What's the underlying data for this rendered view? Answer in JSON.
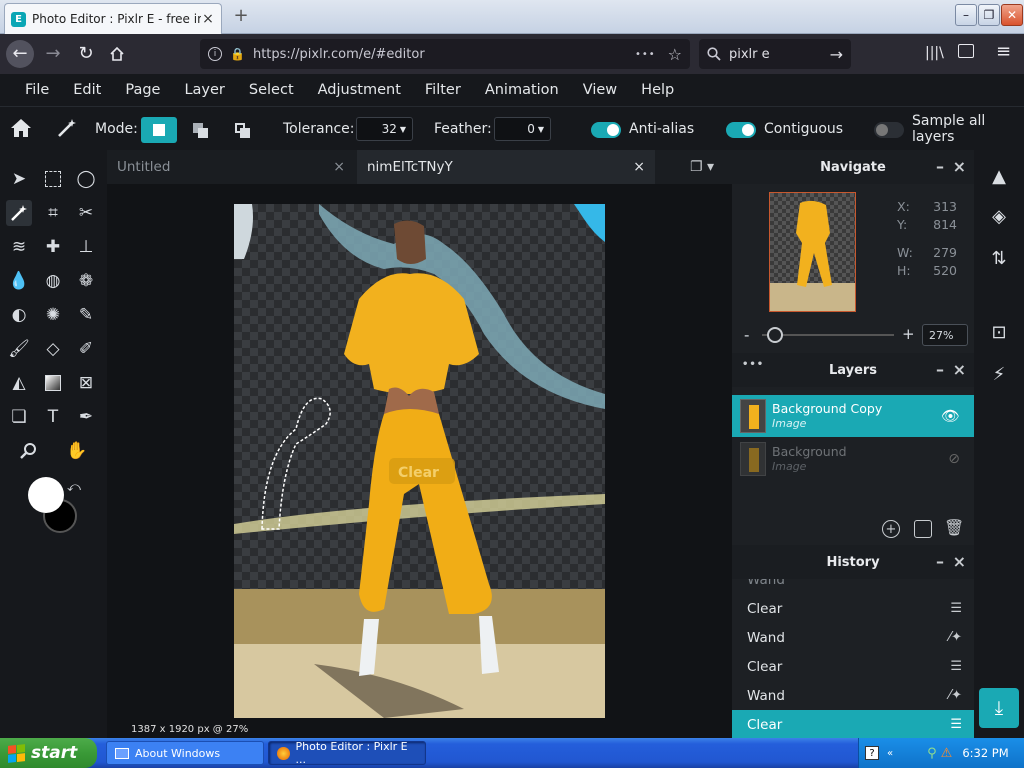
{
  "browser": {
    "tab_title": "Photo Editor : Pixlr E - free image e",
    "url": "https://pixlr.com/e/#editor",
    "search_text": "pixlr e",
    "more_dots": "•••"
  },
  "menu": [
    "File",
    "Edit",
    "Page",
    "Layer",
    "Select",
    "Adjustment",
    "Filter",
    "Animation",
    "View",
    "Help"
  ],
  "options": {
    "mode_label": "Mode:",
    "tolerance_label": "Tolerance:",
    "tolerance_value": "32",
    "feather_label": "Feather:",
    "feather_value": "0",
    "antialias_label": "Anti-alias",
    "contiguous_label": "Contiguous",
    "sample_label": "Sample all layers",
    "antialias_on": true,
    "contiguous_on": true,
    "sample_on": false
  },
  "doc_tabs": [
    {
      "label": "Untitled",
      "active": false
    },
    {
      "label": "nimElTcTNyY",
      "active": true
    }
  ],
  "canvas": {
    "clear_overlay": "Clear",
    "status": "1387 x 1920 px @ 27%"
  },
  "navigate": {
    "title": "Navigate",
    "x_label": "X:",
    "x_value": "313",
    "y_label": "Y:",
    "y_value": "814",
    "w_label": "W:",
    "w_value": "279",
    "h_label": "H:",
    "h_value": "520",
    "zoom": "27%",
    "zoom_level": 0.1,
    "minus": "-",
    "plus": "+"
  },
  "layers": {
    "title": "Layers",
    "menu_dots": "•••",
    "items": [
      {
        "name": "Background Copy",
        "type": "Image",
        "active": true
      },
      {
        "name": "Background",
        "type": "Image",
        "active": false
      }
    ]
  },
  "history": {
    "title": "History",
    "partial_top": "Wand",
    "items": [
      {
        "label": "Clear",
        "icon": "document-icon"
      },
      {
        "label": "Wand",
        "icon": "magic-wand-icon"
      },
      {
        "label": "Clear",
        "icon": "document-icon"
      },
      {
        "label": "Wand",
        "icon": "magic-wand-icon"
      },
      {
        "label": "Clear",
        "icon": "document-icon",
        "active": true
      }
    ]
  },
  "taskbar": {
    "start": "start",
    "items": [
      "About Windows",
      "Photo Editor : Pixlr E ..."
    ],
    "time": "6:32 PM"
  },
  "colors": {
    "accent": "#1aa9b4",
    "panel": "#1d2024",
    "toolbar": "#16181c",
    "primary_color": "#ffffff",
    "secondary_color": "#000000"
  }
}
